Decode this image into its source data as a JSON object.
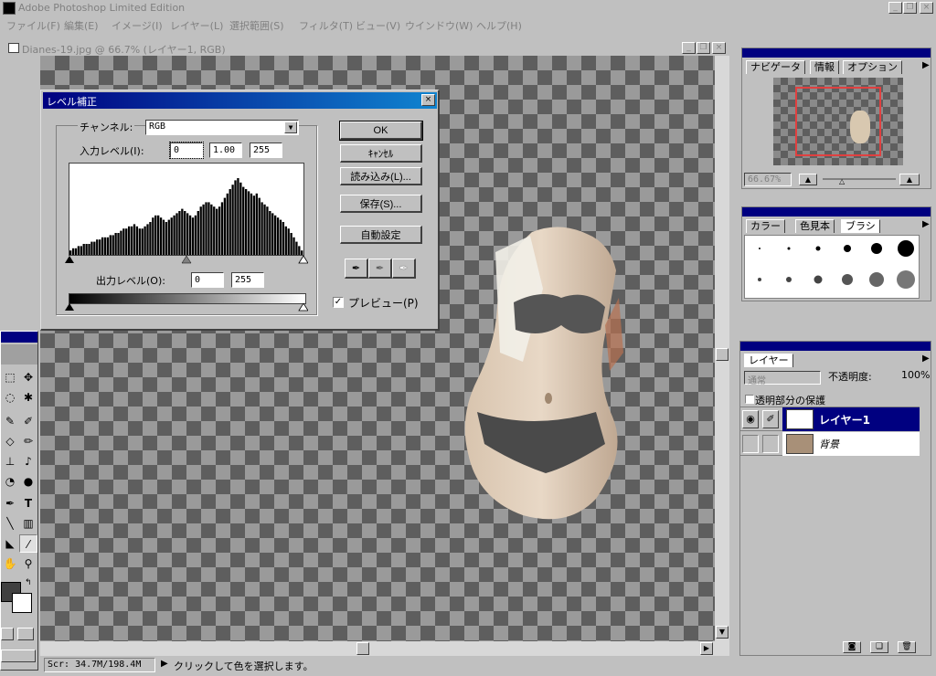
{
  "app": {
    "title": "Adobe Photoshop Limited Edition",
    "menu": [
      "ファイル(F)",
      "編集(E)",
      "イメージ(I)",
      "レイヤー(L)",
      "選択範囲(S)",
      "フィルタ(T)",
      "ビュー(V)",
      "ウインドウ(W)",
      "ヘルプ(H)"
    ],
    "window_buttons": [
      "_",
      "❐",
      "×"
    ]
  },
  "document": {
    "title": "Dianes-19.jpg @ 66.7% (レイヤー1, RGB)"
  },
  "levels": {
    "title": "レベル補正",
    "channel_label": "チャンネル:",
    "channel_value": "RGB",
    "input_label": "入力レベル(I):",
    "input_values": [
      "0",
      "1.00",
      "255"
    ],
    "output_label": "出力レベル(O):",
    "output_values": [
      "0",
      "255"
    ],
    "buttons": {
      "ok": "OK",
      "cancel": "ｷｬﾝｾﾙ",
      "load": "読み込み(L)...",
      "save": "保存(S)...",
      "auto": "自動設定"
    },
    "preview_label": "プレビュー(P)",
    "preview_checked": true,
    "histogram": [
      2,
      3,
      3,
      4,
      4,
      5,
      5,
      5,
      6,
      6,
      7,
      7,
      8,
      8,
      8,
      9,
      9,
      10,
      10,
      11,
      12,
      12,
      13,
      13,
      14,
      13,
      12,
      12,
      13,
      14,
      15,
      17,
      18,
      18,
      17,
      16,
      15,
      16,
      17,
      18,
      19,
      20,
      21,
      20,
      19,
      18,
      17,
      18,
      20,
      22,
      23,
      24,
      24,
      23,
      22,
      21,
      22,
      24,
      26,
      28,
      30,
      32,
      34,
      35,
      33,
      31,
      30,
      29,
      28,
      27,
      28,
      26,
      24,
      23,
      22,
      20,
      19,
      18,
      17,
      16,
      15,
      13,
      12,
      10,
      8,
      6,
      4,
      2
    ]
  },
  "navigator": {
    "tabs": [
      "ナビゲータ",
      "情報",
      "オプション"
    ],
    "zoom": "66.67%"
  },
  "brushes": {
    "tabs": [
      "カラー",
      "色見本",
      "ブラシ"
    ]
  },
  "layers": {
    "tabs": [
      "レイヤー"
    ],
    "blend_mode": "通常",
    "opacity_label": "不透明度:",
    "opacity_value": "100%",
    "preserve_label": "透明部分の保護",
    "items": [
      {
        "name": "レイヤー1",
        "active": true
      },
      {
        "name": "背景",
        "active": false
      }
    ]
  },
  "status": {
    "scratch": "Scr: 34.7M/198.4M",
    "message": "クリックして色を選択します。"
  },
  "colors": {
    "titlebar_active": "#000080",
    "titlebar_gradient_end": "#1084d0",
    "selection": "#000080",
    "navigator_box": "#e04040"
  }
}
